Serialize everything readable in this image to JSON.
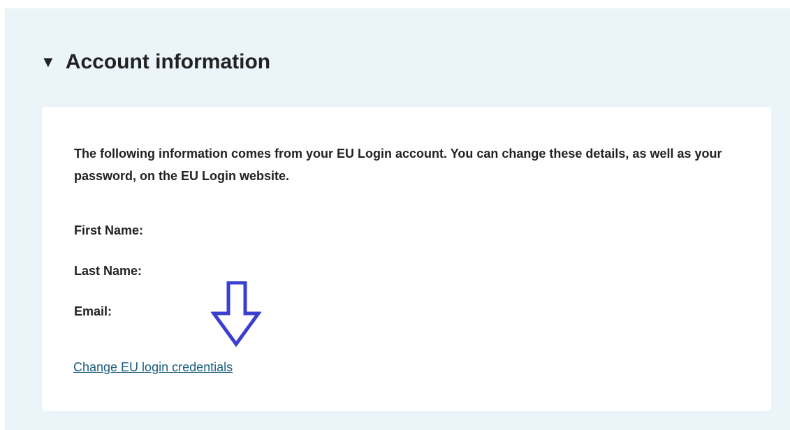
{
  "section": {
    "toggle_glyph": "▼",
    "title": "Account information"
  },
  "card": {
    "intro": "The following information comes from your EU Login account. You can change these details, as well as your password, on the EU Login website.",
    "fields": {
      "first_name_label": "First Name:",
      "last_name_label": "Last Name:",
      "email_label": "Email:"
    },
    "link_label": "Change EU login credentials"
  },
  "annotation": {
    "arrow_icon": "down-arrow-icon",
    "arrow_color": "#3a3fcf"
  },
  "colors": {
    "panel_bg": "#eaf4f9",
    "card_bg": "#ffffff",
    "text": "#222222",
    "link": "#1b5e7d"
  }
}
